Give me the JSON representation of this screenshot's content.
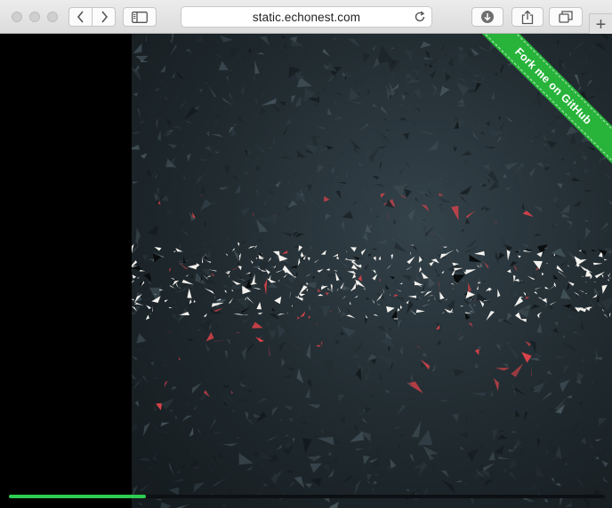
{
  "browser": {
    "url": "static.echonest.com",
    "toolbar_icons": {
      "back": "chevron-left-icon",
      "forward": "chevron-right-icon",
      "sidebar": "sidebar-icon",
      "reload": "reload-icon",
      "download": "download-icon",
      "share": "share-icon",
      "tabs": "tabs-icon",
      "new_tab": "+"
    }
  },
  "page": {
    "ribbon_label": "Fork me on GitHub",
    "ribbon_color": "#28b33a",
    "progress_fraction": 0.23,
    "progress_color": "#2ecc52",
    "accent_shard_color": "#e0434a"
  }
}
